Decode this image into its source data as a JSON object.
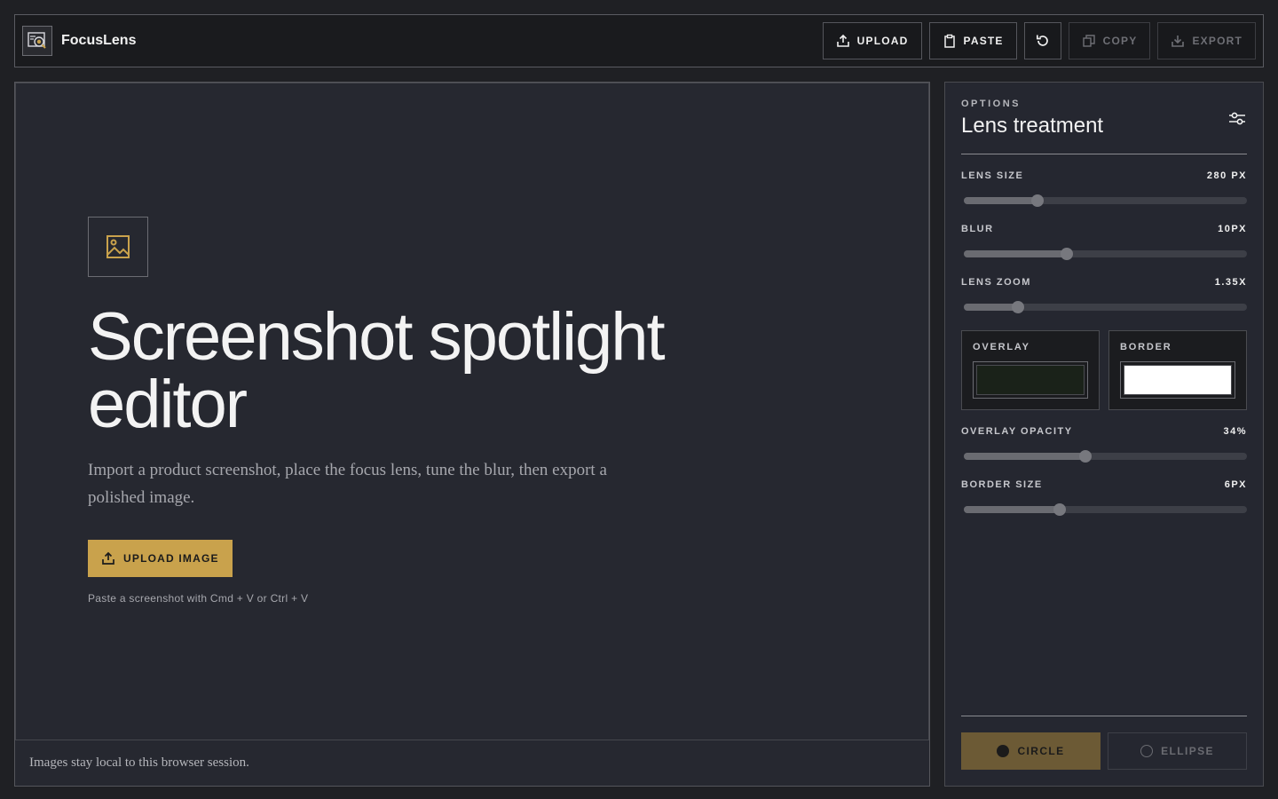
{
  "app": {
    "title": "FocusLens",
    "logo_icon": "focus-lens-logo-icon"
  },
  "toolbar": {
    "upload_label": "UPLOAD",
    "paste_label": "PASTE",
    "reset_icon": "reset-icon",
    "copy_label": "COPY",
    "export_label": "EXPORT"
  },
  "hero": {
    "title": "Screenshot spotlight editor",
    "description": "Import a product screenshot, place the focus lens, tune the blur, then export a polished image.",
    "cta_label": "UPLOAD IMAGE",
    "hint": "Paste a screenshot with Cmd + V or Ctrl + V"
  },
  "canvas_footer": "Images stay local to this browser session.",
  "options": {
    "overline": "OPTIONS",
    "title": "Lens treatment",
    "controls": [
      {
        "label": "LENS SIZE",
        "value": "280 PX",
        "level": 0.26
      },
      {
        "label": "BLUR",
        "value": "10PX",
        "level": 0.365
      },
      {
        "label": "LENS ZOOM",
        "value": "1.35X",
        "level": 0.19
      },
      {
        "label": "OVERLAY OPACITY",
        "value": "34%",
        "level": 0.43
      },
      {
        "label": "BORDER SIZE",
        "value": "6PX",
        "level": 0.34
      }
    ],
    "overlay": {
      "label": "OVERLAY",
      "color": "#1a2219"
    },
    "border": {
      "label": "BORDER",
      "color": "#ffffff"
    },
    "shape": {
      "circle_label": "CIRCLE",
      "ellipse_label": "ELLIPSE",
      "selected": "circle"
    }
  },
  "colors": {
    "accent": "#c9a24c",
    "background": "#1f2024",
    "panel": "#252730"
  }
}
